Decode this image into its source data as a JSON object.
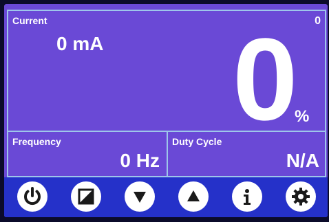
{
  "current": {
    "label": "Current",
    "value": "0 mA",
    "corner": "0"
  },
  "output": {
    "percent_value": "0",
    "percent_unit": "%"
  },
  "frequency": {
    "label": "Frequency",
    "value": "0 Hz"
  },
  "duty_cycle": {
    "label": "Duty Cycle",
    "value": "N/A"
  },
  "toolbar": {
    "buttons": [
      {
        "name": "power"
      },
      {
        "name": "square-half"
      },
      {
        "name": "arrow-down"
      },
      {
        "name": "arrow-up"
      },
      {
        "name": "info"
      },
      {
        "name": "gear"
      }
    ]
  },
  "colors": {
    "screen_bg": "#6a49d6",
    "toolbar_bg": "#2531c9",
    "border": "#9ec6ea",
    "icon": "#1a1a1a"
  }
}
